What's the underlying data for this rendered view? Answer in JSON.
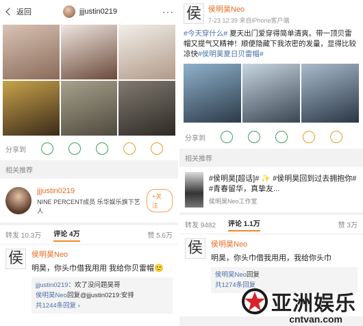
{
  "left": {
    "nav": {
      "back_label": "返回",
      "username": "jjjustin0219",
      "more": "···"
    },
    "share_label": "分享到",
    "section_title": "相关推荐",
    "recommend": {
      "name": "jjjustin0219",
      "desc": "NINE PERCENT成员 乐华娱乐旗下艺人",
      "follow": "+关注"
    },
    "tabs": {
      "repost": "转发 10.3万",
      "comment": "评论 4万",
      "like": "赞 5.6万"
    },
    "comment": {
      "name": "侯明昊Neo",
      "text": "明昊，你头巾借我用用 我给你贝雷帽🙂",
      "replies": [
        {
          "name": "jjjustin0219",
          "text": "：欢了没问题昊哥"
        },
        {
          "name": "侯明昊Neo",
          "text": "回复@jjjustin0219:安排"
        }
      ],
      "more": "共1244条回复 ›"
    }
  },
  "right": {
    "post": {
      "name": "侯明昊Neo",
      "meta": "7-23 12:39  来自iPhone客户端",
      "text_hash1": "#今天穿什么#",
      "text_body": " 夏天出门爱穿得简单清爽。带一顶贝雷帽又提气又精神！顺便隐藏下我浓密的发量，显得比较凉快",
      "text_hash2": "#侯明昊夏日贝雷帽#"
    },
    "section_title": "相关推荐",
    "recommend": {
      "title": "#侯明昊[超话]# ✨ #侯明昊回到过去拥抱你# #青春留华，真挚友...",
      "source": "侯明昊Neo工作室"
    },
    "tabs": {
      "repost": "转发 9482",
      "comment": "评论 1.1万",
      "like": "赞 3万"
    },
    "comment": {
      "name": "侯明昊Neo",
      "text": "明昊，你头巾借我用用，我给你头巾",
      "reply_name": "侯明昊Neo",
      "reply_text": "回复",
      "more": "共1274条回复"
    }
  },
  "watermark": {
    "cn": "亚洲娱乐",
    "url": "cntvan.com"
  },
  "colors": {
    "accent": "#e76a22",
    "link": "#4a6fa8",
    "icon_green": "#3d9e5a",
    "icon_orange": "#e79b2a"
  }
}
